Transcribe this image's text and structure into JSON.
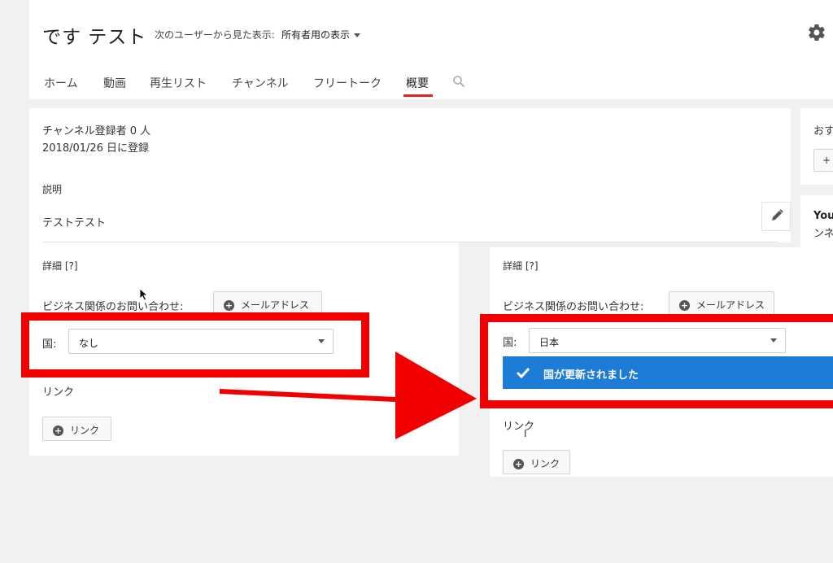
{
  "header": {
    "channel_title": "です テスト",
    "view_as_label": "次のユーザーから見た表示:",
    "view_as_value": "所有者用の表示",
    "tabs": [
      {
        "label": "ホーム"
      },
      {
        "label": "動画"
      },
      {
        "label": "再生リスト"
      },
      {
        "label": "チャンネル"
      },
      {
        "label": "フリートーク"
      },
      {
        "label": "概要",
        "active": true
      }
    ]
  },
  "about": {
    "subscribers": "チャンネル登録者 0 人",
    "joined": "2018/01/26 日に登録",
    "description_label": "説明",
    "description_text": "テストテスト"
  },
  "before": {
    "details_label": "詳細 [?]",
    "business_label": "ビジネス関係のお問い合わせ:",
    "email_button": "メールアドレス",
    "country_label": "国:",
    "country_value": "なし",
    "links_label": "リンク",
    "link_button": "リンク"
  },
  "after": {
    "details_label": "詳細 [?]",
    "business_label": "ビジネス関係のお問い合わせ:",
    "email_button": "メールアドレス",
    "country_label": "国:",
    "country_value": "日本",
    "toast": "国が更新されました",
    "links_label": "リンク",
    "link_button": "リンク"
  },
  "sidebar": {
    "card1_text": "おす",
    "card1_button": "+",
    "card2_line1": "You",
    "card2_line2": "ンネ"
  },
  "colors": {
    "accent_red": "#f20000",
    "tab_underline": "#e62117",
    "toast_blue": "#1c7cd6"
  },
  "icons": [
    "gear-icon",
    "search-icon",
    "pencil-icon",
    "plus-circle-icon",
    "checkmark-icon",
    "cursor-icon"
  ]
}
